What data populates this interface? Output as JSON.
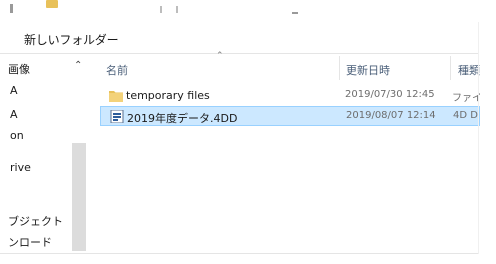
{
  "toolbar": {
    "new_folder_label": "新しいフォルダー"
  },
  "nav": {
    "items": [
      {
        "label": "画像"
      },
      {
        "label": "A"
      },
      {
        "label": "A"
      },
      {
        "label": "on"
      },
      {
        "label": "rive"
      },
      {
        "label": "ブジェクト"
      },
      {
        "label": "ンロード"
      }
    ]
  },
  "columns": {
    "name": "名前",
    "modified": "更新日時",
    "type": "種類"
  },
  "files": [
    {
      "name": "temporary files",
      "modified": "2019/07/30 12:45",
      "type": "ファイル",
      "icon": "folder-icon",
      "selected": false
    },
    {
      "name": "2019年度データ.4DD",
      "modified": "2019/08/07 12:14",
      "type": "4D D",
      "icon": "4d-data-file-icon",
      "selected": true
    }
  ],
  "colors": {
    "selection_bg": "#cce8ff",
    "selection_border": "#99d1ff",
    "folder": "#e8c15a"
  }
}
